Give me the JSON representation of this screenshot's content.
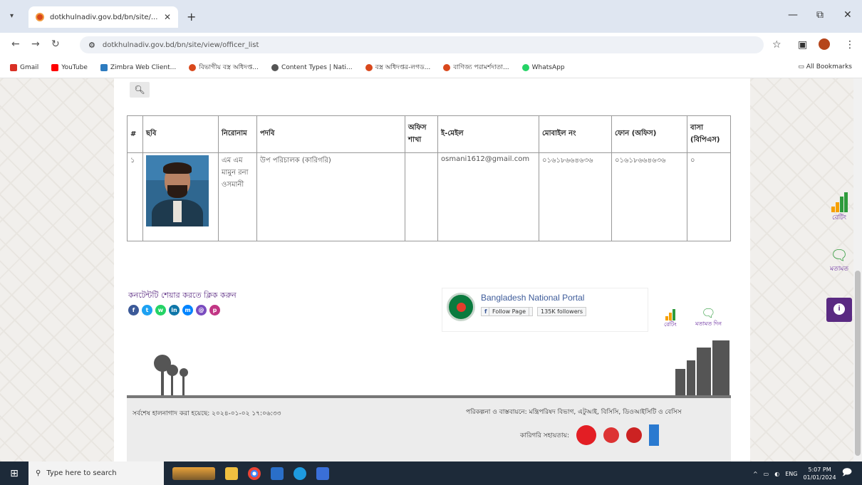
{
  "browser": {
    "tab_title": "dotkhulnadiv.gov.bd/bn/site/...",
    "url": "dotkhulnadiv.gov.bd/bn/site/view/officer_list",
    "bookmarks": [
      "Gmail",
      "YouTube",
      "Zimbra Web Client...",
      "বিভাগীয় বস্ত্র অধিদপ্ত...",
      "Content Types | Nati...",
      "বস্ত্র অধিদপ্তর-লগড...",
      "বাণিজ্য পরামর্শদাতা...",
      "WhatsApp"
    ],
    "all_bookmarks": "All Bookmarks"
  },
  "table": {
    "headers": [
      "#",
      "ছবি",
      "নিরোনাম",
      "পদবি",
      "অফিস শাখা",
      "ই-মেইল",
      "মোবাইল নং",
      "ফোন (অফিস)",
      "বাসা (বিপিএস)"
    ],
    "rows": [
      {
        "num": "১",
        "name": "এম এম মামুন রনা ওসমানী",
        "designation": "উপ পরিচালক (কারিগরি)",
        "branch": "",
        "email": "osmani1612@gmail.com",
        "mobile": "০১৬১৮৬৬৪৬৩৬",
        "phone": "০১৬১৮৬৬৪৬৩৬",
        "home": "০"
      }
    ]
  },
  "footer": {
    "connect_text": "কনটেন্টটি শেয়ার করতে ক্লিক করুন",
    "portal_name": "Bangladesh National Portal",
    "follow_page": "Follow Page",
    "followers": "135K followers",
    "rate_label": "রেটিং",
    "feedback_label": "মতামত দিন",
    "updated": "সর্বশেষ হালনাগাদ করা হয়েছে: ২০২৪-০১-০২ ১৭:০৬:৩৩",
    "planning": "পরিকল্পনা ও বাস্তবায়নে: মন্ত্রিপরিষদ বিভাগ, এটুআই, বিসিসি, ডিওআইসিটি ও বেসিস",
    "technical": "কারিগরি সহায়তায়:"
  },
  "side": {
    "rating": "রেটিং",
    "feedback": "মতামত"
  },
  "taskbar": {
    "search_placeholder": "Type here to search",
    "time": "5:07 PM",
    "date": "01/01/2024",
    "lang": "ENG"
  }
}
